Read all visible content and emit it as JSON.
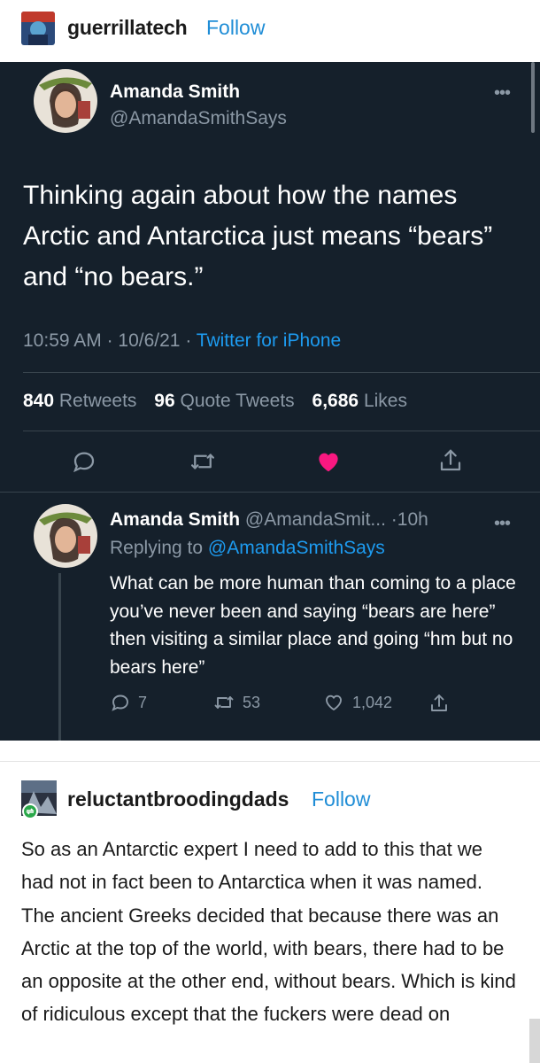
{
  "post1": {
    "username": "guerrillatech",
    "follow_label": "Follow"
  },
  "tweet": {
    "author_name": "Amanda Smith",
    "author_handle": "@AmandaSmithSays",
    "more_label": "•••",
    "text": "Thinking again about how the names Arctic and Antarctica just means “bears” and “no bears.”",
    "time": "10:59 AM",
    "date": "10/6/21",
    "source": "Twitter for iPhone",
    "retweets_count": "840",
    "retweets_label": "Retweets",
    "quotes_count": "96",
    "quotes_label": "Quote Tweets",
    "likes_count": "6,686",
    "likes_label": "Likes",
    "like_color": "#f91880",
    "icons": [
      "reply-icon",
      "retweet-icon",
      "heart-icon",
      "share-icon"
    ]
  },
  "reply": {
    "author_name": "Amanda Smith",
    "author_handle": "@AmandaSmit...",
    "age": "·10h",
    "more_label": "•••",
    "replying_prefix": "Replying to",
    "replying_to": "@AmandaSmithSays",
    "text": "What can be more human than coming to a place you’ve never been and saying “bears are here” then visiting a similar place and going “hm but no bears here”",
    "reply_count": "7",
    "retweet_count": "53",
    "like_count": "1,042"
  },
  "post2": {
    "username": "reluctantbroodingdads",
    "follow_label": "Follow",
    "body": "So as an Antarctic expert I need to add to this that we had not in fact been to Antarctica when it was named. The ancient Greeks decided that because there was an Arctic at the top of the world, with bears, there had to be an opposite at the other end, without bears. Which is kind of ridiculous except that the fuckers were dead on"
  },
  "colors": {
    "tweet_bg": "#15202b",
    "tumblr_link": "#1f8dd6",
    "twitter_link": "#1d9bf0",
    "muted": "#8b98a5"
  }
}
